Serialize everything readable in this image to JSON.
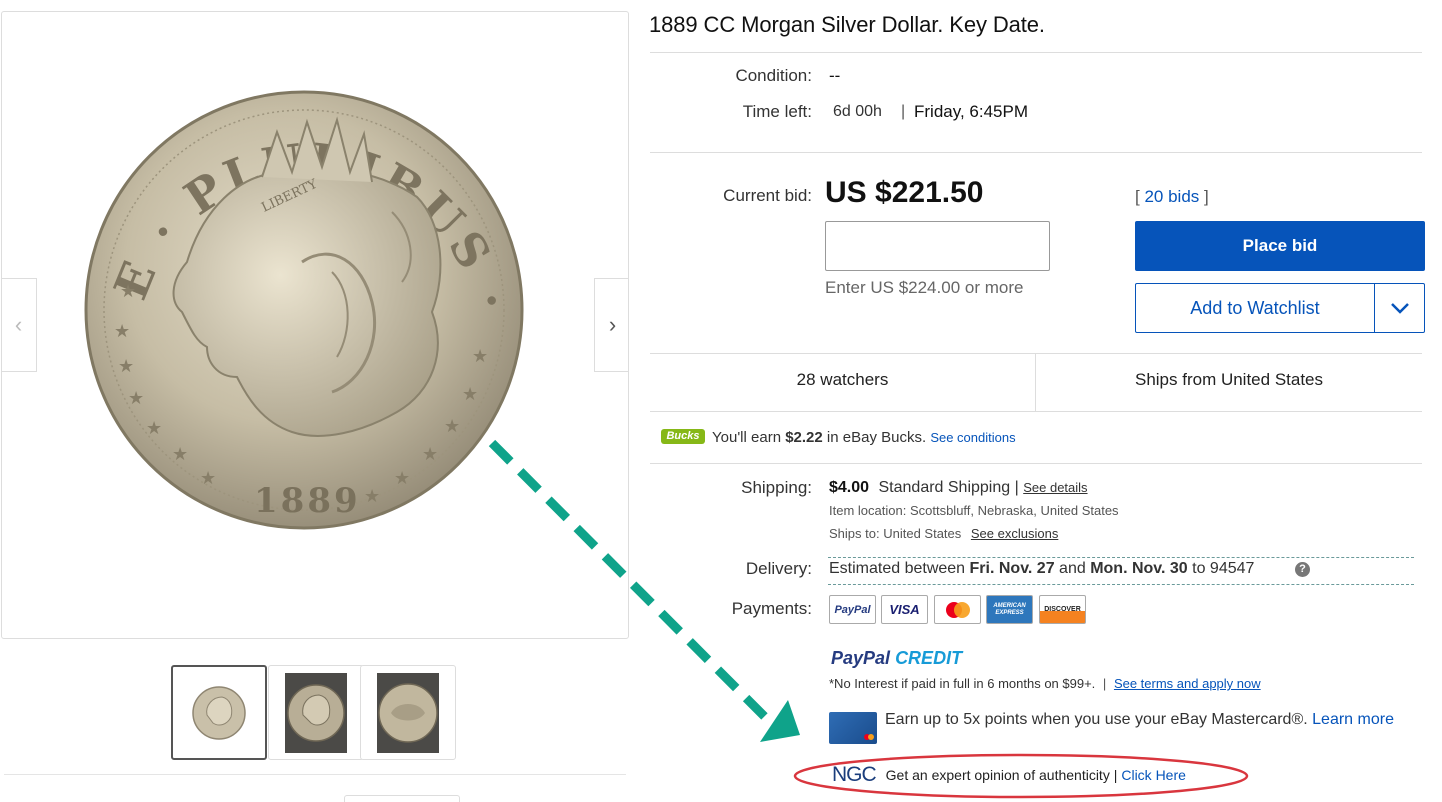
{
  "listing": {
    "title": "1889 CC Morgan Silver Dollar. Key Date.",
    "condition_label": "Condition:",
    "condition_value": "--",
    "time_left_label": "Time left:",
    "time_left_value": "6d 00h",
    "separator": "|",
    "end_time": "Friday, 6:45PM"
  },
  "bid": {
    "current_bid_label": "Current bid:",
    "current_bid_value": "US $221.50",
    "bids_open": "[",
    "bids_count": "20 bids",
    "bids_close": "]",
    "input_value": "",
    "hint": "Enter US $224.00 or more",
    "place_bid_label": "Place bid",
    "watchlist_label": "Add to Watchlist"
  },
  "stats": {
    "watchers": "28 watchers",
    "ships_from": "Ships from United States"
  },
  "bucks": {
    "badge": "Bucks",
    "text_prefix": "You'll earn ",
    "amount": "$2.22",
    "text_suffix": " in eBay Bucks.",
    "link": "See conditions"
  },
  "shipping": {
    "label": "Shipping:",
    "price": "$4.00",
    "method": "Standard Shipping |",
    "details_link": "See details",
    "location_label": "Item location:",
    "location_value": "Scottsbluff, Nebraska, United States",
    "ships_to_label": "Ships to:",
    "ships_to_value": "United States",
    "exclusions_link": "See exclusions"
  },
  "delivery": {
    "label": "Delivery:",
    "text_1": "Estimated between ",
    "date_1": "Fri. Nov. 27",
    "text_2": " and ",
    "date_2": "Mon. Nov. 30",
    "text_3": " to 94547",
    "help_icon": "?"
  },
  "payments": {
    "label": "Payments:",
    "cards": [
      "PayPal",
      "VISA",
      "",
      "AMERICAN EXPRESS",
      "DISCOVER"
    ],
    "paypal_credit_1": "PayPal",
    "paypal_credit_2": "CREDIT",
    "credit_note": "*No Interest if paid in full in 6 months on $99+.",
    "credit_sep": "|",
    "credit_link": "See terms and apply now",
    "mastercard_text": "Earn up to 5x points when you use your eBay Mastercard®.",
    "mastercard_link_1": "Learn",
    "mastercard_link_2": "more"
  },
  "ngc": {
    "logo": "NGC",
    "text": "Get an expert opinion of authenticity |",
    "link": "Click Here"
  },
  "coin": {
    "legend_top": "E · PLURIBUS · UNUM",
    "year": "1889",
    "liberty": "LIBERTY"
  },
  "colors": {
    "ebay_blue": "#0654ba",
    "arrow_teal": "#0fa38a",
    "highlight_red": "#d9363e",
    "bucks_green": "#86b817"
  }
}
